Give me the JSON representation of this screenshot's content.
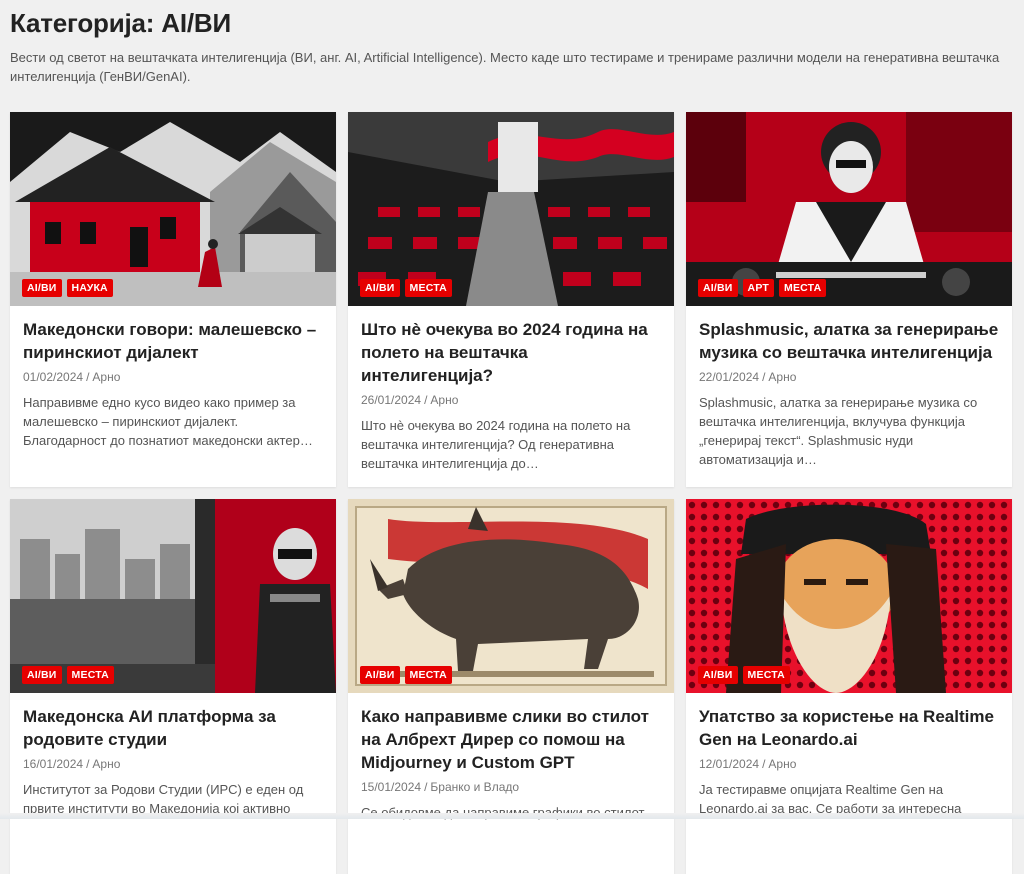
{
  "page": {
    "title": "Категорија: AI/ВИ",
    "description": "Вести од светот на вештачката интелигенција (ВИ, анг. AI, Artificial Intelligence). Место каде што тестираме и тренираме различни модели на генеративна вештачка интелигенција (ГенВИ/GenAI)."
  },
  "colors": {
    "accent": "#e60000",
    "background": "#f0f0f0"
  },
  "posts": [
    {
      "categories": [
        "AI/ВИ",
        "НАУКА"
      ],
      "title": "Македонски говори: малешевско – пиринскиот дијалект",
      "date": "01/02/2024",
      "author": "Арно",
      "excerpt": "Направивме едно кусо видео како пример за малешевско – пиринскиот дијалект. Благодарност до познатиот македонски актер…",
      "image": "red-house-village-illustration"
    },
    {
      "categories": [
        "AI/ВИ",
        "МЕСТА"
      ],
      "title": "Што нè очекува во 2024 година на полето на вештачка интелигенција?",
      "date": "26/01/2024",
      "author": "Арно",
      "excerpt": "Што нè очекува во 2024 година на полето на вештачка интелигенција? Од генеративна вештачка интелигенција до…",
      "image": "red-lecture-hall-illustration"
    },
    {
      "categories": [
        "AI/ВИ",
        "АРТ",
        "МЕСТА"
      ],
      "title": "Splashmusic, алатка за генерирање музика со вештачка интелигенција",
      "date": "22/01/2024",
      "author": "Арно",
      "excerpt": "Splashmusic, алатка за генерирање музика со вештачка интелигенција, вклучува функција „генерирај текст“. Splashmusic нуди автоматизација и…",
      "image": "dj-illustration"
    },
    {
      "categories": [
        "AI/ВИ",
        "МЕСТА"
      ],
      "title": "Македонска АИ платформа за родовите студии",
      "date": "16/01/2024",
      "author": "Арно",
      "excerpt": "Институтот за Родови Студии (ИРС) е еден од првите институти во Македонија кој активно",
      "image": "robot-window-city-illustration"
    },
    {
      "categories": [
        "AI/ВИ",
        "МЕСТА"
      ],
      "title": "Како направивме слики во стилот на Албрехт Дирер со помош на Midjourney и Custom GPT",
      "date": "15/01/2024",
      "author": "Бранко и Владо",
      "excerpt": "Се обидовме да направиме графики во стилот",
      "image": "rhinoceros-engraving"
    },
    {
      "categories": [
        "AI/ВИ",
        "МЕСТА"
      ],
      "title": "Упатство за користење на Realtime Gen на Leonardo.ai",
      "date": "12/01/2024",
      "author": "Арно",
      "excerpt": "Ја тестиравме опцијата Realtime Gen на Leonardo.ai за вас. Се работи за интересна",
      "image": "bearded-man-pop-art"
    }
  ]
}
